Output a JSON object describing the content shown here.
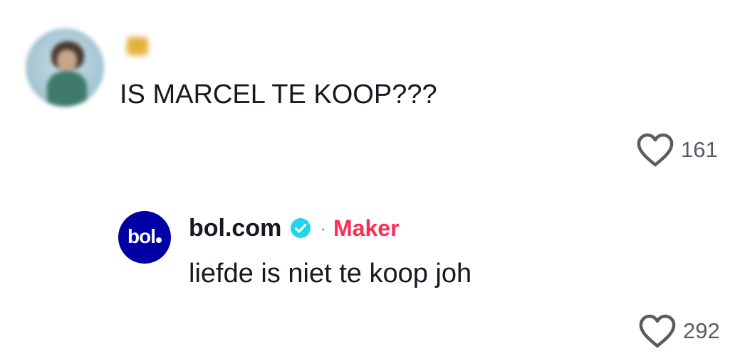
{
  "comment": {
    "avatar_icon": "user-avatar-icon",
    "username": "",
    "text": "IS MARCEL TE KOOP???",
    "likes": "161",
    "like_icon": "heart-outline-icon"
  },
  "reply": {
    "avatar_text": "bol",
    "name": "bol.com",
    "verified_icon": "verified-badge-icon",
    "separator": "·",
    "creator_label": "Maker",
    "text": "liefde is niet te koop joh",
    "likes": "292",
    "like_icon": "heart-outline-icon"
  },
  "colors": {
    "text_primary": "#161823",
    "text_secondary": "#5a5b63",
    "creator_accent": "#fe2c55",
    "verified_blue": "#20d5ec",
    "brand_blue": "#0000a4"
  }
}
